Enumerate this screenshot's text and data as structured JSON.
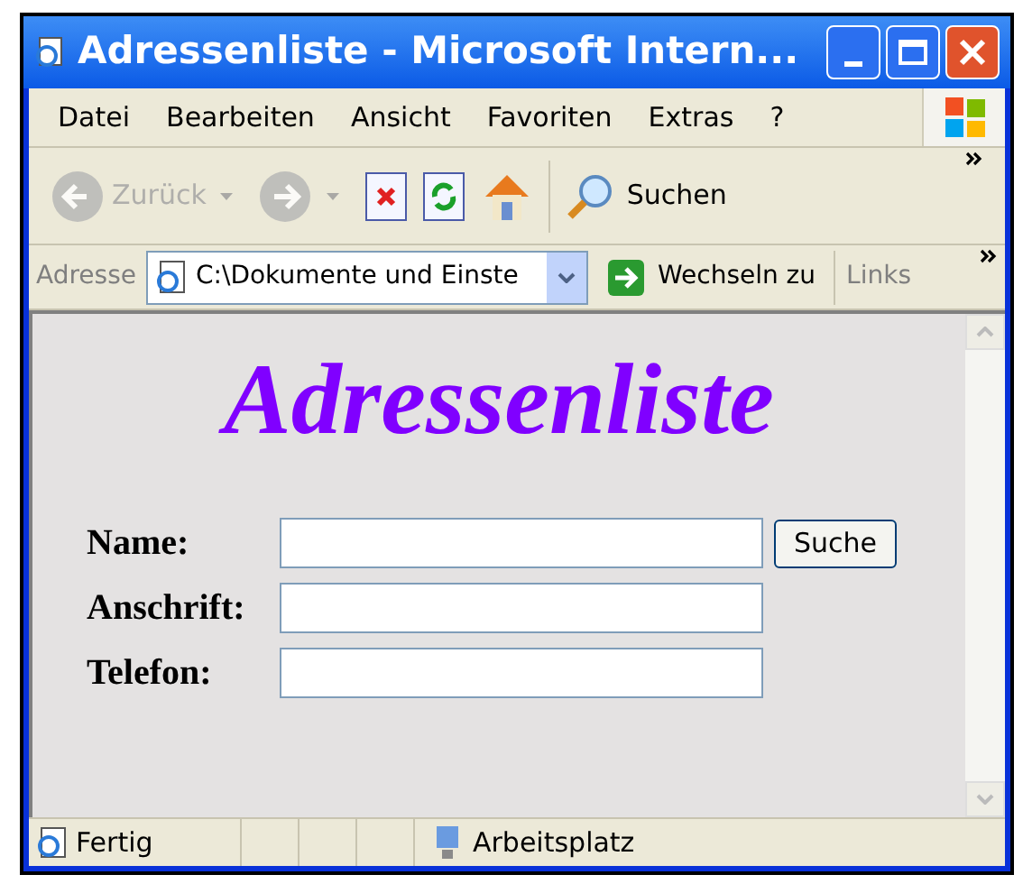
{
  "window": {
    "title": "Adressenliste - Microsoft Intern..."
  },
  "menu": [
    "Datei",
    "Bearbeiten",
    "Ansicht",
    "Favoriten",
    "Extras",
    "?"
  ],
  "toolbar": {
    "back": {
      "label": "Zurück",
      "disabled": true
    },
    "forward": {
      "disabled": true
    },
    "search": {
      "label": "Suchen"
    }
  },
  "address_bar": {
    "label": "Adresse",
    "value": "C:\\Dokumente und Einste",
    "go": "Wechseln zu",
    "links": "Links"
  },
  "page": {
    "heading": "Adressenliste",
    "fields": [
      {
        "label": "Name:",
        "button": "Suche"
      },
      {
        "label": "Anschrift:"
      },
      {
        "label": "Telefon:"
      }
    ]
  },
  "status_bar": {
    "text": "Fertig",
    "zone": "Arbeitsplatz"
  }
}
